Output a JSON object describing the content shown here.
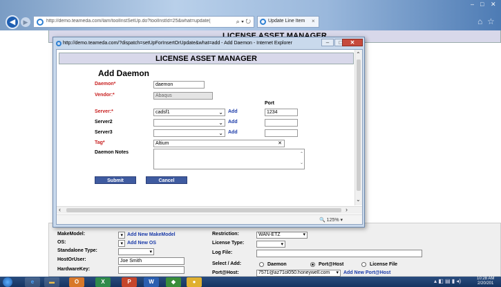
{
  "browser": {
    "address": "http://demo.teameda.com/lam/toolInstSetUp.do?toolInstId=25&what=update(",
    "tab_label": "Update Line Item",
    "tab_close": "×"
  },
  "page": {
    "header": "LICENSE ASSET MANAGER",
    "form": {
      "makemodel_label": "MakeModel:",
      "add_makemodel": "Add New MakeModel",
      "os_label": "OS:",
      "add_os": "Add New OS",
      "standalone_label": "Standalone Type:",
      "hostoruser_label": "HostOrUser:",
      "hostoruser_value": "Joe Smith",
      "hardwarekey_label": "HardwareKey:",
      "restriction_label": "Restriction:",
      "restriction_value": "WAN-ETZ",
      "license_type_label": "License Type:",
      "log_file_label": "Log File:",
      "select_add_label": "Select / Add:",
      "radio_daemon": "Daemon",
      "radio_porthost": "Port@Host",
      "radio_license_file": "License File",
      "porthost_label": "Port@Host:",
      "porthost_value": "7571@az71ol050.honeywell.com",
      "add_porthost": "Add New Port@Host"
    }
  },
  "popup": {
    "window_title": "http://demo.teameda.com/?dispatch=setUpForInsertOrUpdate&what=add - Add Daemon - Internet Explorer",
    "header": "LICENSE ASSET MANAGER",
    "form_title": "Add Daemon",
    "port_header": "Port",
    "fields": {
      "daemon_label": "Daemon*",
      "daemon_value": "daemon",
      "vendor_label": "Vendor:*",
      "vendor_value": "Abaqus",
      "server_label": "Server:*",
      "server_value": "cadsf1",
      "server_port": "1234",
      "server2_label": "Server2",
      "server3_label": "Server3",
      "add_link": "Add",
      "tag_label": "Tag*",
      "tag_value": "Altium",
      "notes_label": "Daemon Notes"
    },
    "buttons": {
      "submit": "Submit",
      "cancel": "Cancel"
    },
    "zoom": "125%"
  },
  "taskbar": {
    "time": "10:28 AM",
    "date": "2/20/201"
  },
  "colors": {
    "required_label": "#c81e1e",
    "link": "#1a3aa8",
    "button": "#3f5ba0",
    "header_bg": "#d8d8ea"
  }
}
